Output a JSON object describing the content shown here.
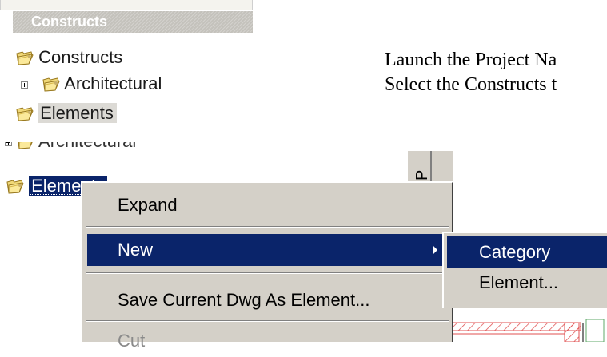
{
  "tree_panel": {
    "header": "Constructs",
    "items": [
      {
        "label": "Constructs",
        "icon": "folder-icon"
      },
      {
        "label": "Architectural",
        "icon": "folder-icon",
        "expander": "plus"
      },
      {
        "label": "Elements",
        "icon": "folder-icon",
        "selected": true
      }
    ]
  },
  "doc_text": {
    "line1": "Launch the Project Na",
    "line2": "Select the Constructs t"
  },
  "lower_tree": {
    "partial_label": "Architectural",
    "selected_label": "Elements"
  },
  "side_tab": {
    "label": "P"
  },
  "context_menu": {
    "items": [
      {
        "label": "Expand"
      },
      {
        "label": "New",
        "has_submenu": true,
        "highlighted": true
      },
      {
        "label": "Save Current Dwg As Element..."
      },
      {
        "label": "Cut",
        "disabled": true
      }
    ]
  },
  "submenu": {
    "items": [
      {
        "label": "Category",
        "highlighted": true
      },
      {
        "label": "Element..."
      }
    ]
  },
  "colors": {
    "selection": "#0a246a",
    "menu_bg": "#d4d0c8",
    "header_bg": "#c4c2bc"
  }
}
